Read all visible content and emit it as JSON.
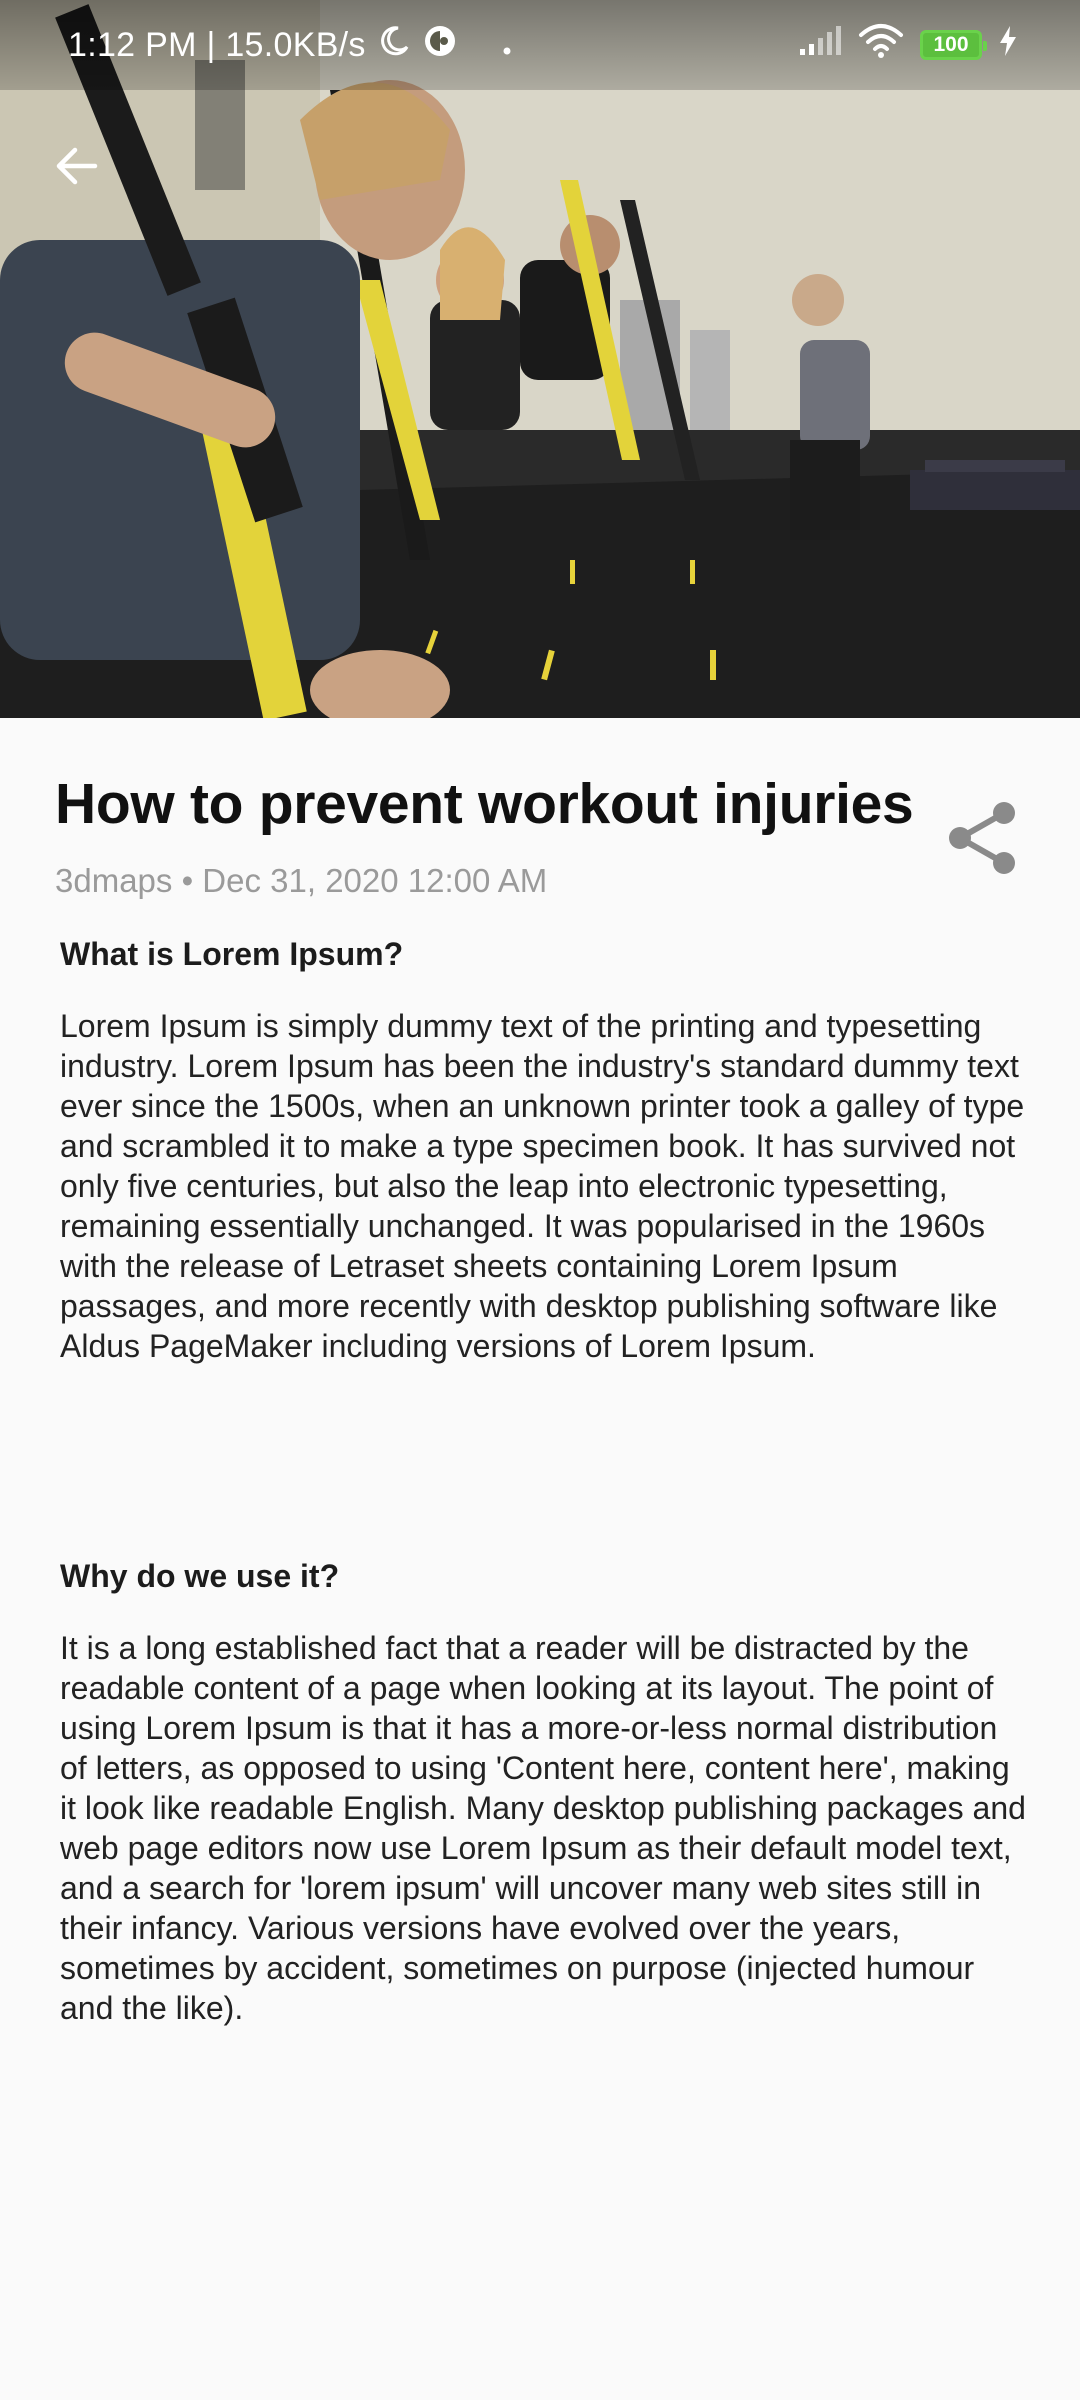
{
  "status_bar": {
    "time_speed": "1:12 PM | 15.0KB/s",
    "battery_level": "100",
    "icons": [
      "moon-icon",
      "data-saver-icon",
      "dot-icon",
      "signal-icon",
      "wifi-icon",
      "battery-icon",
      "charging-icon"
    ]
  },
  "header": {
    "back_icon": "back-arrow-icon"
  },
  "article": {
    "title": "How to prevent workout injuries",
    "meta": "3dmaps • Dec 31, 2020 12:00 AM",
    "share_icon": "share-icon",
    "sections": [
      {
        "heading": "What is Lorem Ipsum?",
        "body": "Lorem Ipsum is simply dummy text of the printing and typesetting industry. Lorem Ipsum has been the industry's standard dummy text ever since the 1500s, when an unknown printer took a galley of type and scrambled it to make a type specimen book. It has survived not only five centuries, but also the leap into electronic typesetting, remaining essentially unchanged. It was popularised in the 1960s with the release of Letraset sheets containing Lorem Ipsum passages, and more recently with desktop publishing software like Aldus PageMaker including versions of Lorem Ipsum."
      },
      {
        "heading": "Why do we use it?",
        "body": "It is a long established fact that a reader will be distracted by the readable content of a page when looking at its layout. The point of using Lorem Ipsum is that it has a more-or-less normal distribution of letters, as opposed to using 'Content here, content here', making it look like readable English. Many desktop publishing packages and web page editors now use Lorem Ipsum as their default model text, and a search for 'lorem ipsum' will uncover many web sites still in their infancy. Various versions have evolved over the years, sometimes by accident, sometimes on purpose (injected humour and the like)."
      }
    ]
  },
  "colors": {
    "background": "#fafafa",
    "title": "#111111",
    "meta": "#9a9a9a",
    "body": "#222222",
    "battery": "#5cbf3e",
    "share_icon": "#8a8a8a"
  }
}
